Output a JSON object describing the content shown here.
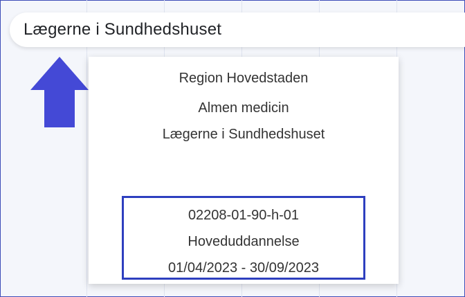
{
  "search": {
    "value": "Lægerne i Sundhedshuset"
  },
  "icons": {
    "arrow": "arrow-up-icon",
    "arrow_color": "#4449d6"
  },
  "colors": {
    "highlight_border": "#2e3fbf",
    "frame_border": "#3d4db8"
  },
  "tooltip": {
    "region": "Region Hovedstaden",
    "specialty": "Almen medicin",
    "clinic": "Lægerne i Sundhedshuset",
    "position_code": "02208-01-90-h-01",
    "program": "Hoveduddannelse",
    "period": "01/04/2023 - 30/09/2023"
  }
}
